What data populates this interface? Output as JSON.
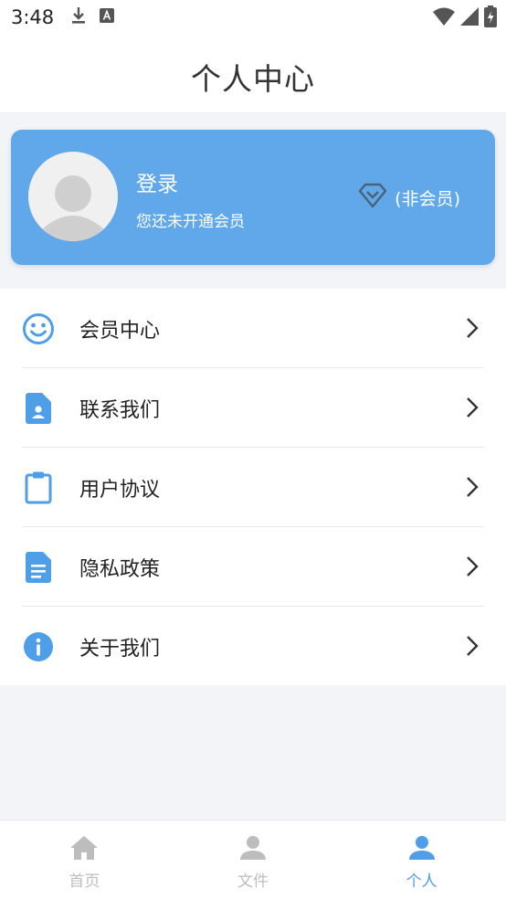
{
  "status_bar": {
    "time": "3:48"
  },
  "header": {
    "title": "个人中心"
  },
  "profile": {
    "login_label": "登录",
    "membership_hint": "您还未开通会员",
    "member_status": "(非会员)"
  },
  "menu": {
    "items": [
      {
        "label": "会员中心",
        "icon": "smiley-icon"
      },
      {
        "label": "联系我们",
        "icon": "contact-card-icon"
      },
      {
        "label": "用户协议",
        "icon": "clipboard-icon"
      },
      {
        "label": "隐私政策",
        "icon": "document-icon"
      },
      {
        "label": "关于我们",
        "icon": "info-icon"
      }
    ]
  },
  "tabbar": {
    "tabs": [
      {
        "label": "首页",
        "icon": "home-icon",
        "active": false
      },
      {
        "label": "文件",
        "icon": "person-icon",
        "active": false
      },
      {
        "label": "个人",
        "icon": "person-icon",
        "active": true
      }
    ]
  },
  "colors": {
    "accent": "#4f9fe8",
    "card_bg": "#60a8ea",
    "inactive_tab": "#bdbdbd",
    "background": "#f2f4f7"
  }
}
